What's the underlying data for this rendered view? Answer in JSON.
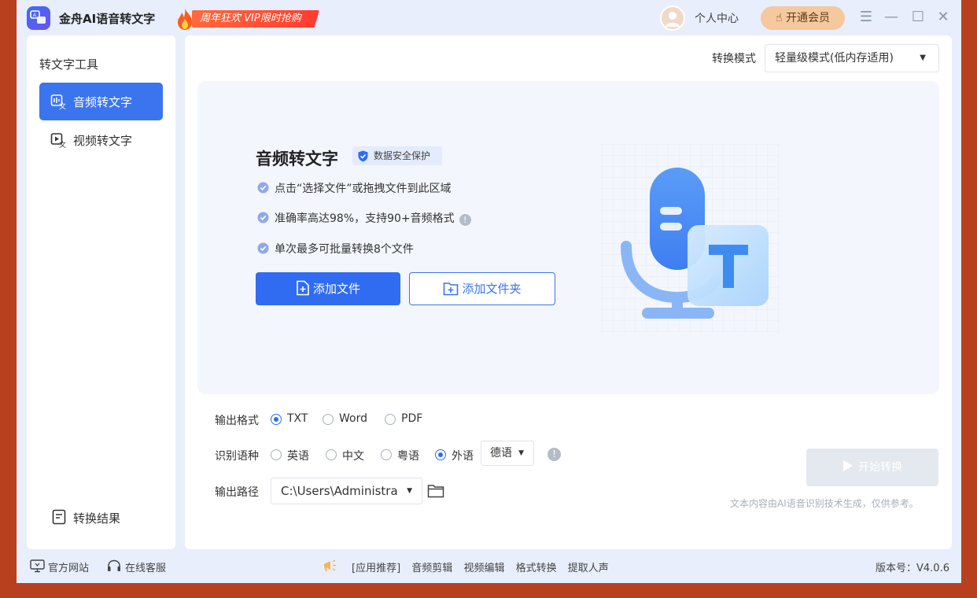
{
  "app": {
    "title": "金舟AI语音转文字",
    "promo_text": "周年狂欢 VIP限时抢购",
    "user_center": "个人中心",
    "vip_button": "开通会员"
  },
  "sidebar": {
    "heading": "转文字工具",
    "items": [
      {
        "label": "音频转文字",
        "icon": "audio-to-text-icon",
        "active": true
      },
      {
        "label": "视频转文字",
        "icon": "video-to-text-icon",
        "active": false
      }
    ],
    "result_label": "转换结果"
  },
  "main": {
    "mode_label": "转换模式",
    "mode_value": "轻量级模式(低内存适用)",
    "drop_zone": {
      "title": "音频转文字",
      "security_badge": "数据安全保护",
      "features": [
        "点击“选择文件”或拖拽文件到此区域",
        "准确率高达98%，支持90+音频格式",
        "单次最多可批量转换8个文件"
      ],
      "add_file": "添加文件",
      "add_folder": "添加文件夹"
    },
    "output_format": {
      "label": "输出格式",
      "options": [
        "TXT",
        "Word",
        "PDF"
      ],
      "selected": "TXT"
    },
    "language": {
      "label": "识别语种",
      "options": [
        "英语",
        "中文",
        "粤语",
        "外语"
      ],
      "selected": "外语",
      "foreign_value": "德语"
    },
    "output_path": {
      "label": "输出路径",
      "value": "C:\\Users\\Administra"
    },
    "start_button": "开始转换",
    "disclaimer": "文本内容由AI语音识别技术生成，仅供参考。"
  },
  "footer": {
    "website": "官方网站",
    "support": "在线客服",
    "recommend": "[应用推荐]",
    "links": [
      "音频剪辑",
      "视频编辑",
      "格式转换",
      "提取人声"
    ],
    "version": "版本号：V4.0.6"
  },
  "colors": {
    "accent": "#2f6cf1",
    "frame": "#b8401e",
    "vip": "#f6c89d"
  }
}
